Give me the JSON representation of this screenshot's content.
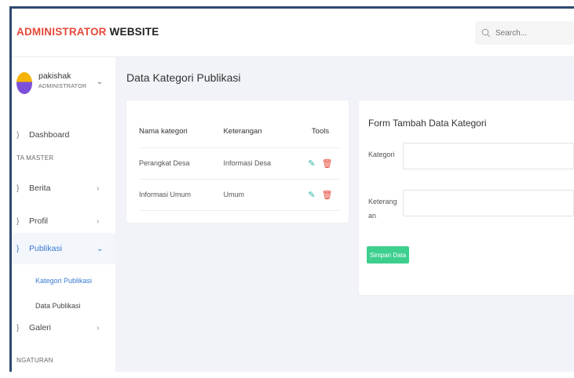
{
  "header": {
    "brand_accent": "ADMINISTRATOR",
    "brand_rest": " WEBSITE",
    "search_placeholder": "Search..."
  },
  "user": {
    "name": "pakishak",
    "role": "ADMINISTRATOR"
  },
  "sidebar": {
    "items": [
      {
        "label": "Dashboard"
      },
      {
        "section": "TA MASTER"
      },
      {
        "label": "Berita",
        "chevron": "›"
      },
      {
        "label": "Profil",
        "chevron": "›"
      },
      {
        "label": "Publikasi",
        "chevron": "⌄"
      },
      {
        "label": "Kategori Publikasi"
      },
      {
        "label": "Data Publikasi"
      },
      {
        "label": "Galeri",
        "chevron": "›"
      },
      {
        "section": "NGATURAN"
      }
    ]
  },
  "main": {
    "page_title": "Data Kategori Publikasi",
    "table": {
      "headers": [
        "Nama kategori",
        "Keterangan",
        "Tools"
      ],
      "rows": [
        [
          "Perangkat Desa",
          "Informasi Desa"
        ],
        [
          "Informasi Umum",
          "Umum"
        ]
      ]
    },
    "form": {
      "title": "Form Tambah Data Kategori",
      "kategori_label": "Kategori",
      "keterangan_label_1": "Keterang",
      "keterangan_label_2": "an",
      "submit_label": "Simpan Data"
    }
  },
  "colors": {
    "accent_red": "#e5493a",
    "active_blue": "#3a7bd5",
    "save_green": "#3dcf8e",
    "edit_teal": "#2bb5a0"
  }
}
